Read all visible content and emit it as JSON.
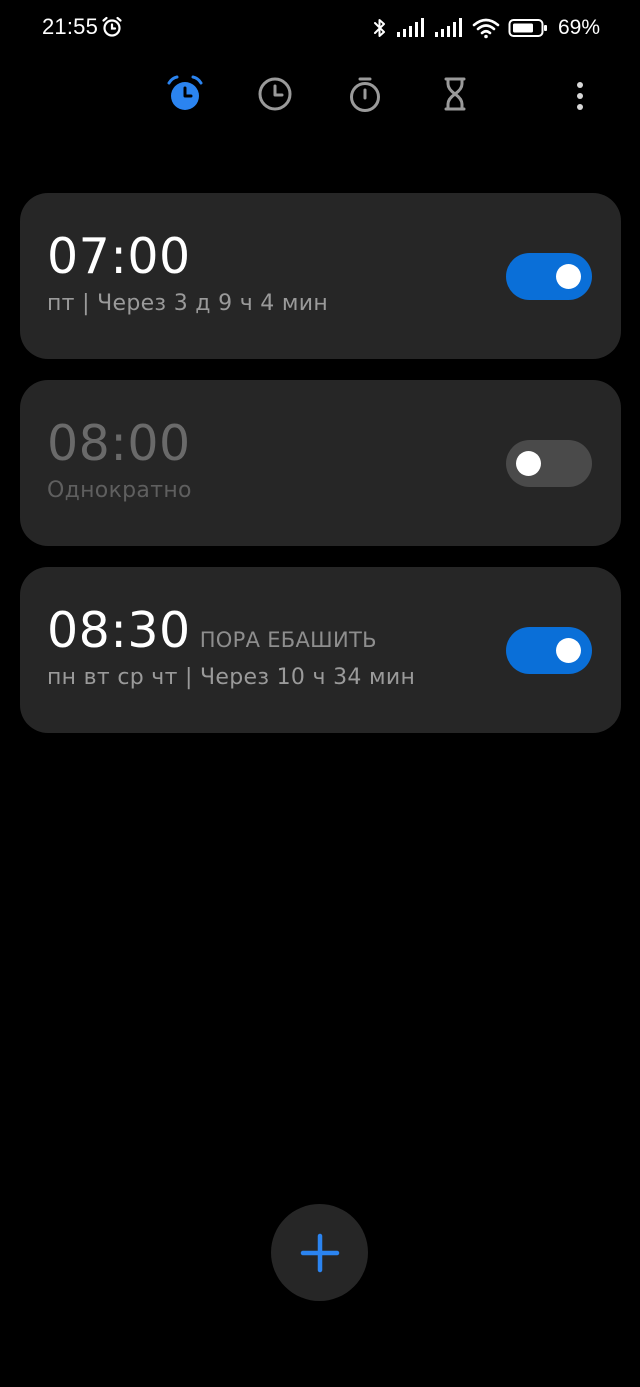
{
  "status_bar": {
    "time": "21:55",
    "battery": "69%",
    "icons": [
      "alarm-icon",
      "bluetooth-icon",
      "signal-icon",
      "signal-icon",
      "wifi-icon",
      "battery-icon"
    ]
  },
  "tabs": [
    {
      "name": "alarm",
      "icon": "alarm-icon",
      "active": true
    },
    {
      "name": "clock",
      "icon": "clock-icon",
      "active": false
    },
    {
      "name": "stopwatch",
      "icon": "stopwatch-icon",
      "active": false
    },
    {
      "name": "timer",
      "icon": "hourglass-icon",
      "active": false
    }
  ],
  "alarms": [
    {
      "time": "07:00",
      "label": "",
      "subtitle": "пт | Через 3 д 9 ч 4 мин",
      "enabled": true
    },
    {
      "time": "08:00",
      "label": "",
      "subtitle": "Однократно",
      "enabled": false
    },
    {
      "time": "08:30",
      "label": "ПОРА ЕБАШИТЬ",
      "subtitle": "пн вт ср чт | Через 10 ч 34 мин",
      "enabled": true
    }
  ],
  "colors": {
    "background": "#000000",
    "card": "#262626",
    "accent": "#0a6fd8",
    "active_tab": "#2b84f0"
  }
}
